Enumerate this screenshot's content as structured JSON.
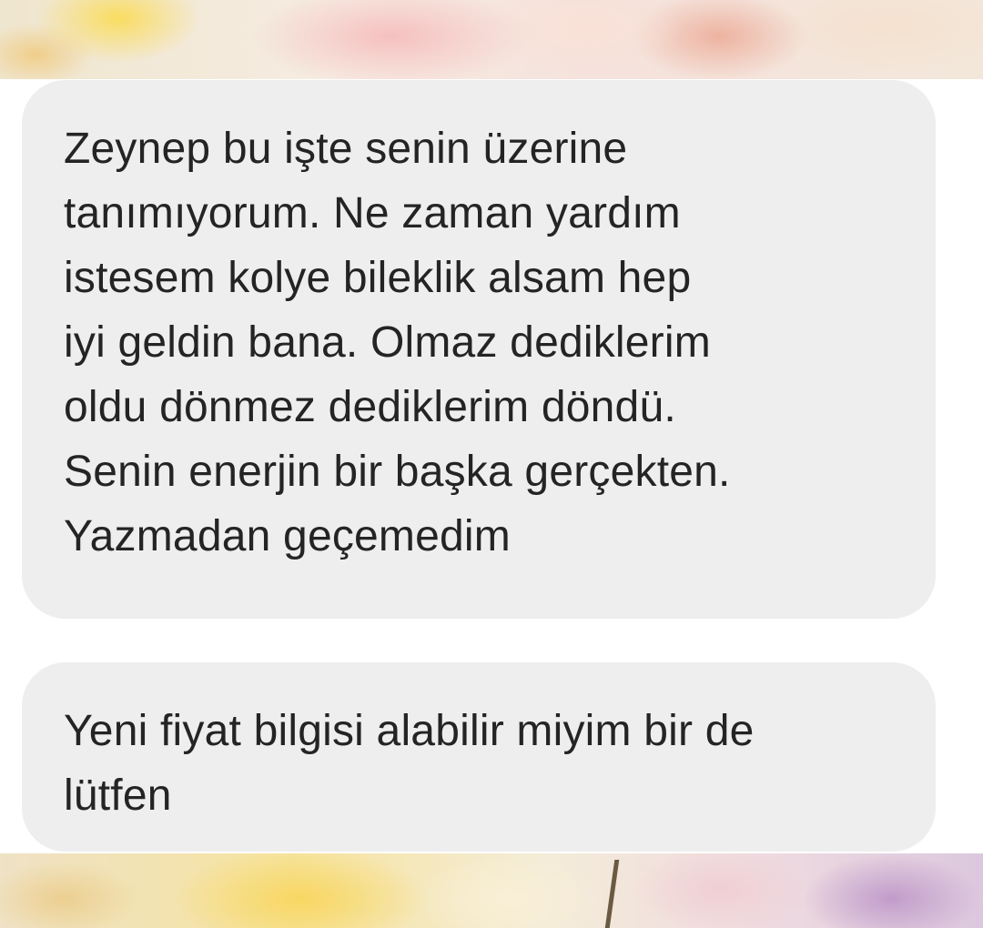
{
  "messages": [
    {
      "lines": [
        "Zeynep bu işte senin üzerine",
        "tanımıyorum. Ne zaman yardım",
        "istesem kolye bileklik alsam hep",
        "iyi geldin bana. Olmaz dediklerim",
        "oldu dönmez dediklerim döndü.",
        "Senin enerjin bir başka gerçekten.",
        "Yazmadan geçemedim"
      ]
    },
    {
      "lines": [
        "Yeni fiyat bilgisi alabilir miyim bir de",
        "lütfen"
      ]
    }
  ],
  "colors": {
    "bubble_background": "#eeeeee",
    "text": "#242424",
    "page_background": "#ffffff"
  }
}
